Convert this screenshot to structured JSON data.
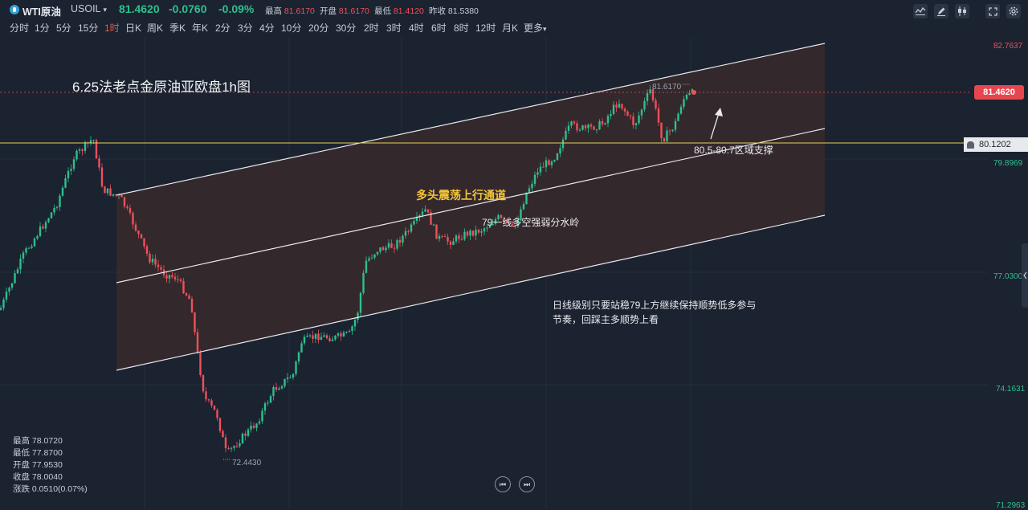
{
  "header": {
    "instrument": "WTI原油",
    "symbol": "USOIL",
    "dropdown_glyph": "▾",
    "last_price": "81.4620",
    "change": "-0.0760",
    "change_pct": "-0.09%",
    "stats": [
      {
        "label": "最高",
        "value": "81.6170"
      },
      {
        "label": "开盘",
        "value": "81.6170"
      },
      {
        "label": "最低",
        "value": "81.4120"
      },
      {
        "label": "昨收",
        "value": "81.5380"
      }
    ],
    "colors": {
      "up": "#2fbf8f",
      "down": "#f0505a",
      "accent": "#f05a3c"
    },
    "toolbar_icons": [
      "indicator-icon",
      "draw-pen-icon",
      "candle-type-icon",
      "fullscreen-icon",
      "settings-icon"
    ]
  },
  "periods": {
    "items": [
      "分时",
      "1分",
      "5分",
      "15分",
      "1时",
      "日K",
      "周K",
      "季K",
      "年K",
      "2分",
      "3分",
      "4分",
      "10分",
      "20分",
      "30分",
      "2时",
      "3时",
      "4时",
      "6时",
      "8时",
      "12时",
      "月K",
      "更多"
    ],
    "active": "1时",
    "more_glyph": "▾"
  },
  "chart": {
    "title": "6.25法老点金原油亚欧盘1h图",
    "channel_label": "多头震荡上行通道",
    "midline_label": "79一线多空强弱分水岭",
    "support_label": "80.5-80.7区域支撑",
    "note_line1": "日线级别只要站稳79上方继续保持顺势低多参与",
    "note_line2": "节奏，回踩主多顺势上看",
    "high_marker": "81.6170",
    "low_marker": "72.4430",
    "colors": {
      "up": "#2fbf8f",
      "down": "#f0505a",
      "channel_fill": "#3a2a2c",
      "horizontal_line": "#e6d35a",
      "label_yellow": "#f3c53a"
    }
  },
  "price_axis": {
    "labels": [
      "82.7637",
      "79.8969",
      "77.0300",
      "74.1631",
      "71.2963"
    ],
    "current_price": "81.4620",
    "horizontal_line_price": "80.1202",
    "alert_icon": "bell-icon"
  },
  "ohlc_panel": [
    {
      "label": "最高",
      "value": "78.0720"
    },
    {
      "label": "最低",
      "value": "77.8700"
    },
    {
      "label": "开盘",
      "value": "77.9530"
    },
    {
      "label": "收盘",
      "value": "78.0040"
    },
    {
      "label": "涨跌",
      "value": "0.0510(0.07%)"
    }
  ],
  "navigation": {
    "prev_glyph": "⏮",
    "next_glyph": "⏭"
  }
}
